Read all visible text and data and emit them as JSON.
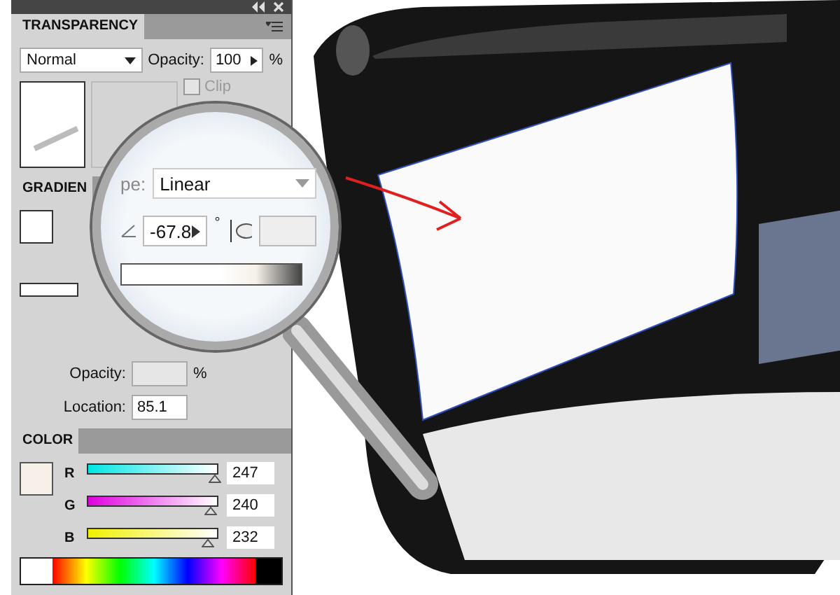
{
  "transparency": {
    "title": "TRANSPARENCY",
    "blend_mode": "Normal",
    "opacity_label": "Opacity:",
    "opacity": "100",
    "opacity_unit": "%",
    "clip": {
      "label": "Clip",
      "checked": false
    }
  },
  "gradient": {
    "title": "GRADIEN",
    "opacity_label": "Opacity:",
    "opacity_unit": "%",
    "location_label": "Location:",
    "location": "85.1"
  },
  "magnifier": {
    "type_label": "pe:",
    "type": "Linear",
    "angle": "-67.8",
    "angle_unit": "°"
  },
  "color": {
    "title": "COLOR",
    "channels": [
      {
        "name": "R",
        "value": "247",
        "level": 0.97
      },
      {
        "name": "G",
        "value": "240",
        "level": 0.94
      },
      {
        "name": "B",
        "value": "232",
        "level": 0.91
      }
    ]
  }
}
